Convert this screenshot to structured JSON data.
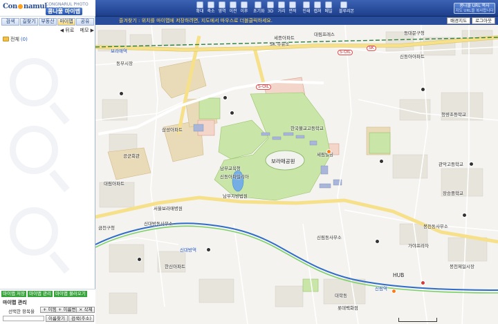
{
  "left_panel": {
    "logo_text_a": "Con",
    "logo_text_b": "namul",
    "service_name": "CONGNARUL PHOTO SERVICE",
    "service_title": "콩나물 마이맵",
    "tabs": [
      {
        "label": "검색",
        "icon": "search-icon"
      },
      {
        "label": "길찾기",
        "icon": "route-icon"
      },
      {
        "label": "부동산",
        "icon": "house-icon"
      },
      {
        "label": "마이맵",
        "icon": "mymap-icon"
      },
      {
        "label": "공유",
        "icon": "share-icon"
      }
    ],
    "sub_actions": [
      "◀ 뒤로",
      "메모 ▶"
    ],
    "folder_label": "전체",
    "folder_count": "(0)",
    "bottom_buttons": [
      "마이맵 저장",
      "마이맵 관리",
      "마이맵 불러오기"
    ],
    "mgmt_title": "마이맵 관리",
    "select_label": "선택한 항목을",
    "select_buttons": [
      "+ 이동",
      "+ 이름변경",
      "× 삭제"
    ],
    "search_buttons": [
      "이름찾기",
      "검색(주소)"
    ]
  },
  "toolbar": {
    "tools": [
      {
        "label": "확대",
        "icon": "zoom-in-icon"
      },
      {
        "label": "축소",
        "icon": "zoom-out-icon"
      },
      {
        "label": "영역",
        "icon": "area-icon"
      },
      {
        "label": "이전",
        "icon": "back-icon"
      },
      {
        "label": "이후",
        "icon": "forward-icon"
      },
      {
        "label": "초기화",
        "icon": "reset-icon"
      },
      {
        "label": "3D",
        "icon": "3d-icon"
      },
      {
        "label": "거리",
        "icon": "distance-icon"
      },
      {
        "label": "면적",
        "icon": "area-measure-icon"
      },
      {
        "label": "인쇄",
        "icon": "print-icon"
      },
      {
        "label": "캡쳐",
        "icon": "capture-icon"
      },
      {
        "label": "메일",
        "icon": "mail-icon"
      },
      {
        "label": "블루리본",
        "icon": "ribbon-icon"
      }
    ],
    "url_title": "콩나물 URL 복사",
    "url_sub": "지도 URL을 복사합니다"
  },
  "map": {
    "notice": "즐겨찾기 : 위치를 마이맵에 저장하려면, 지도에서 마우스로 더블클릭하세요.",
    "controls": [
      "배경지도",
      "로그아웃"
    ],
    "labels": [
      {
        "text": "SK 주유소",
        "kind": "normal"
      },
      {
        "text": "대림프레스",
        "kind": "normal"
      },
      {
        "text": "동대문구청",
        "kind": "normal"
      },
      {
        "text": "세종아파트",
        "kind": "normal"
      },
      {
        "text": "신동아아파트",
        "kind": "normal"
      },
      {
        "text": "동부시장",
        "kind": "normal"
      },
      {
        "text": "보라매공원",
        "kind": "big"
      },
      {
        "text": "한국불교고등학교",
        "kind": "normal"
      },
      {
        "text": "청량초등학교",
        "kind": "normal"
      },
      {
        "text": "세림빌딩",
        "kind": "normal"
      },
      {
        "text": "남부교육청",
        "kind": "normal"
      },
      {
        "text": "삼성아파트",
        "kind": "normal"
      },
      {
        "text": "서울보라매병원",
        "kind": "normal"
      },
      {
        "text": "남부지방법원",
        "kind": "normal"
      },
      {
        "text": "신동아파밀리아",
        "kind": "normal"
      },
      {
        "text": "대림아파트",
        "kind": "normal"
      },
      {
        "text": "신대방동사무소",
        "kind": "normal"
      },
      {
        "text": "금천구청",
        "kind": "normal"
      },
      {
        "text": "보라매역",
        "kind": "blue"
      },
      {
        "text": "신대방역",
        "kind": "blue"
      },
      {
        "text": "신림역",
        "kind": "blue"
      },
      {
        "text": "HUB",
        "kind": "normal"
      },
      {
        "text": "대학동",
        "kind": "normal"
      },
      {
        "text": "봉천동사무소",
        "kind": "normal"
      },
      {
        "text": "관악고등학교",
        "kind": "normal"
      },
      {
        "text": "공군회관",
        "kind": "normal"
      },
      {
        "text": "장승중학교",
        "kind": "normal"
      },
      {
        "text": "신림동사무소",
        "kind": "normal"
      },
      {
        "text": "한신아파트",
        "kind": "normal"
      },
      {
        "text": "롯데백화점",
        "kind": "normal"
      },
      {
        "text": "가야프라자",
        "kind": "normal"
      },
      {
        "text": "봉천제일시장",
        "kind": "normal"
      }
    ],
    "stations": [
      "S-OIL",
      "SK",
      "S-OIL"
    ]
  }
}
